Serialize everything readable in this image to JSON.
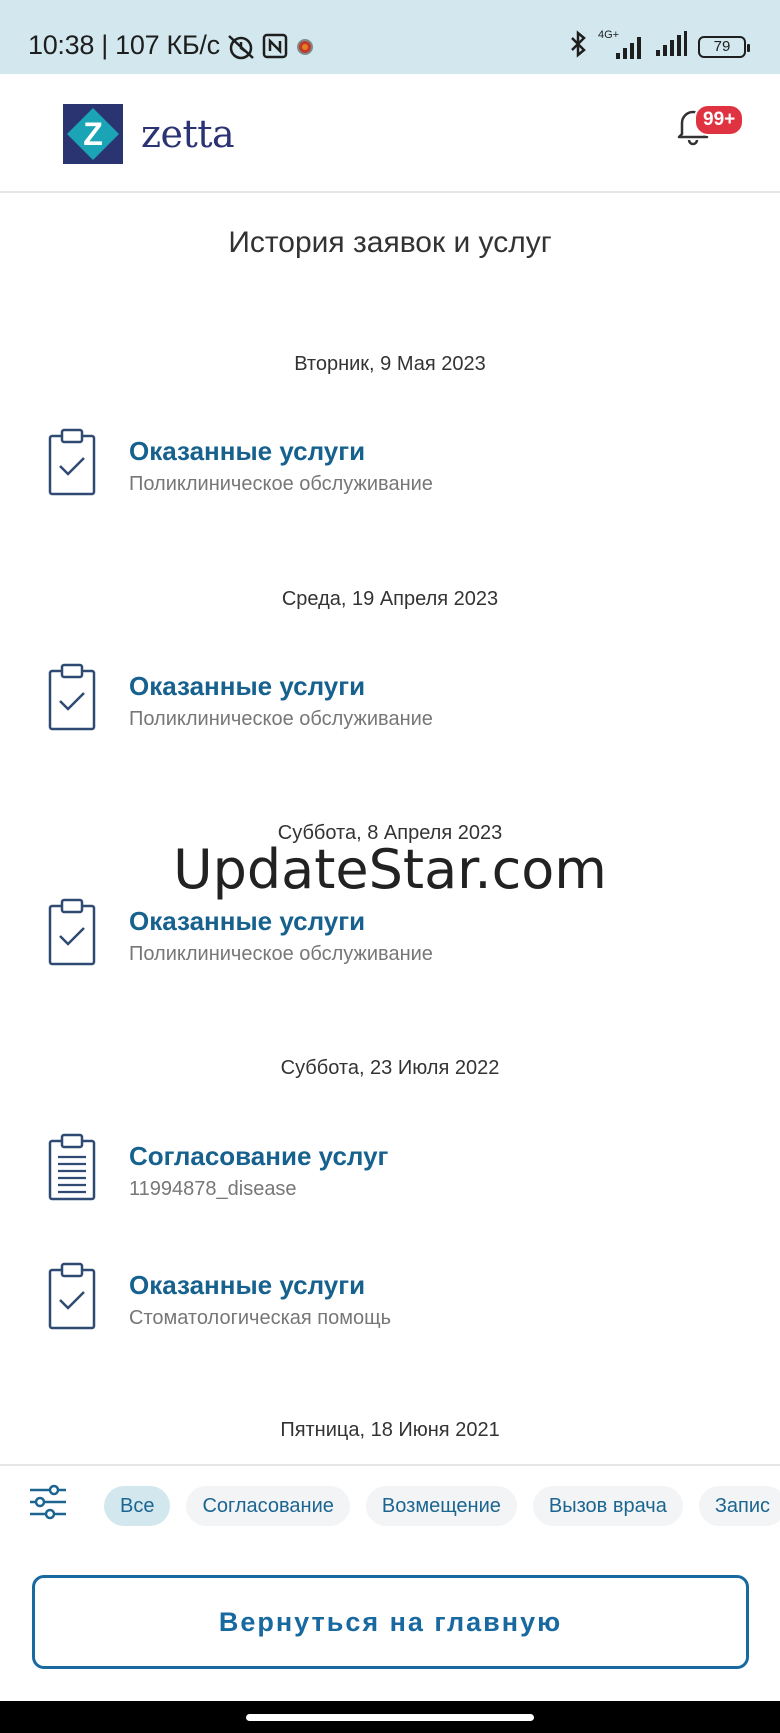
{
  "status_bar": {
    "time_speed": "10:38 | 107 КБ/с",
    "network_label": "4G+",
    "battery": "79"
  },
  "header": {
    "brand": "zetta",
    "brand_mark": "Z",
    "notifications_badge": "99+"
  },
  "page": {
    "title": "История заявок и услуг"
  },
  "history": [
    {
      "date": "Вторник, 9 Мая 2023",
      "items": [
        {
          "icon": "clipboard-check-icon",
          "title": "Оказанные услуги",
          "subtitle": "Поликлиническое обслуживание"
        }
      ]
    },
    {
      "date": "Среда, 19 Апреля 2023",
      "items": [
        {
          "icon": "clipboard-check-icon",
          "title": "Оказанные услуги",
          "subtitle": "Поликлиническое обслуживание"
        }
      ]
    },
    {
      "date": "Суббота, 8 Апреля 2023",
      "items": [
        {
          "icon": "clipboard-check-icon",
          "title": "Оказанные услуги",
          "subtitle": "Поликлиническое обслуживание"
        }
      ]
    },
    {
      "date": "Суббота, 23 Июля 2022",
      "items": [
        {
          "icon": "clipboard-list-icon",
          "title": "Согласование услуг",
          "subtitle": "11994878_disease"
        },
        {
          "icon": "clipboard-check-icon",
          "title": "Оказанные услуги",
          "subtitle": "Стоматологическая помощь"
        }
      ]
    },
    {
      "date": "Пятница, 18 Июня 2021",
      "items": []
    }
  ],
  "watermark": "UpdateStar.com",
  "filters": {
    "icon": "sliders-icon",
    "chips": [
      "Все",
      "Согласование",
      "Возмещение",
      "Вызов врача",
      "Запис"
    ],
    "active": "Все"
  },
  "actions": {
    "home_button": "Вернуться на главную"
  },
  "colors": {
    "accent": "#16618e",
    "status_bar_bg": "#d3e8ee",
    "badge": "#e03342",
    "brand_navy": "#2a3470",
    "brand_teal": "#1ba3b6"
  }
}
